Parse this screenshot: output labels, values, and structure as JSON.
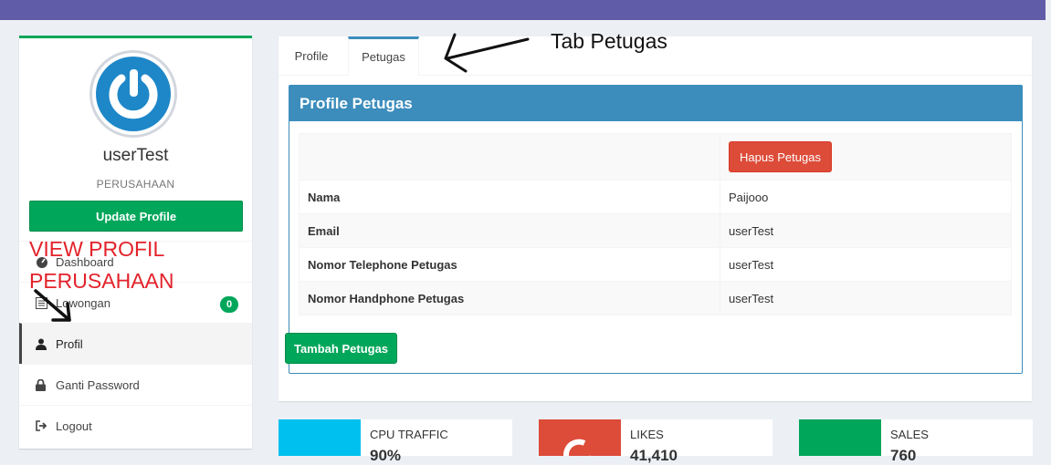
{
  "sidebar": {
    "username": "userTest",
    "role": "PERUSAHAAN",
    "update_button": "Update Profile",
    "nav": [
      {
        "label": "Dashboard",
        "icon": "dashboard-icon"
      },
      {
        "label": "Lowongan",
        "icon": "list-icon",
        "badge": "0"
      },
      {
        "label": "Profil",
        "icon": "user-icon",
        "active": true
      },
      {
        "label": "Ganti Password",
        "icon": "lock-icon"
      },
      {
        "label": "Logout",
        "icon": "sign-out-icon"
      }
    ]
  },
  "tabs": [
    {
      "label": "Profile"
    },
    {
      "label": "Petugas",
      "active": true
    }
  ],
  "annotations": {
    "tab_note": "Tab Petugas",
    "view_line1": "VIEW PROFIL",
    "view_line2": "PERUSAHAAN"
  },
  "panel": {
    "title": "Profile Petugas",
    "delete_button": "Hapus Petugas",
    "rows": [
      {
        "label": "Nama",
        "value": "Paijooo"
      },
      {
        "label": "Email",
        "value": "userTest"
      },
      {
        "label": "Nomor Telephone Petugas",
        "value": "userTest"
      },
      {
        "label": "Nomor Handphone Petugas",
        "value": "userTest"
      }
    ],
    "add_button": "Tambah Petugas"
  },
  "info_boxes": [
    {
      "label": "CPU TRAFFIC",
      "value": "90%",
      "color": "#00c0ef"
    },
    {
      "label": "LIKES",
      "value": "41,410",
      "color": "#dd4b39"
    },
    {
      "label": "SALES",
      "value": "760",
      "color": "#00a65a"
    }
  ],
  "colors": {
    "header": "#605ca8",
    "primary": "#3c8dbc",
    "success": "#00a65a",
    "danger": "#dd4b39"
  }
}
